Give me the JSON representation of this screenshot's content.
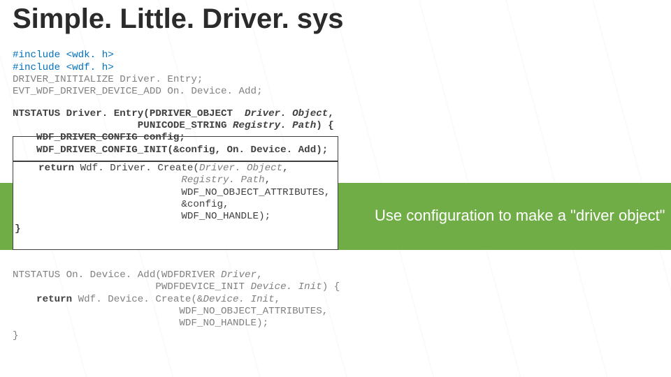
{
  "title": "Simple. Little. Driver. sys",
  "includes": [
    "#include <wdk. h>",
    "#include <wdf. h>",
    "DRIVER_INITIALIZE Driver. Entry;",
    "EVT_WDF_DRIVER_DEVICE_ADD On. Device. Add;"
  ],
  "entry": {
    "sig1": "NTSTATUS Driver. Entry(PDRIVER_OBJECT  ",
    "sig1_param": "Driver. Object",
    "sig1_tail": ",",
    "sig2_pad": "                     PUNICODE_STRING ",
    "sig2_param": "Registry. Path",
    "sig2_tail": ") {",
    "cfg1": "    WDF_DRIVER_CONFIG config;",
    "cfg2": "    WDF_DRIVER_CONFIG_INIT(&config, On. Device. Add);",
    "ret_lead": "    return ",
    "ret_call": "Wdf. Driver. Create(",
    "ret_arg1": "Driver. Object",
    "ret_tail1": ",",
    "pad": "                            ",
    "ret_arg2": "Registry. Path",
    "ret_tail2": ",",
    "ret_arg3": "WDF_NO_OBJECT_ATTRIBUTES",
    "ret_tail3": ",",
    "ret_arg4": "&config,",
    "ret_arg5": "WDF_NO_HANDLE);",
    "close": "}"
  },
  "add": {
    "sig1": "NTSTATUS On. Device. Add(WDFDRIVER ",
    "sig1_param": "Driver",
    "sig1_tail": ",",
    "sig2_pad": "                        PWDFDEVICE_INIT ",
    "sig2_param": "Device. Init",
    "sig2_tail": ") {",
    "ret_lead": "    return ",
    "ret_call": "Wdf. Device. Create(&",
    "ret_arg1": "Device. Init",
    "ret_tail1": ",",
    "pad": "                            ",
    "ret_arg2": "WDF_NO_OBJECT_ATTRIBUTES",
    "ret_tail2": ",",
    "ret_arg3": "WDF_NO_HANDLE);",
    "close": "}"
  },
  "callout": "Use configuration to make a \"driver object\"",
  "colors": {
    "green": "#70ad47",
    "blue": "#0070c0",
    "gray": "#808080",
    "dark": "#404040"
  }
}
